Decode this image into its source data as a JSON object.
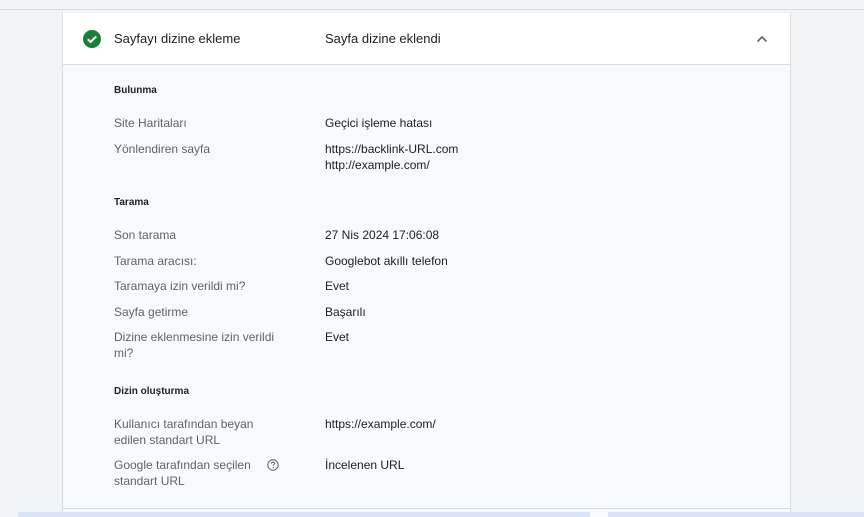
{
  "header": {
    "label": "Sayfayı dizine ekleme",
    "value": "Sayfa dizine eklendi",
    "status_icon": "check-circle-icon",
    "status_color": "#188038",
    "toggle_icon": "chevron-up-icon"
  },
  "sections": {
    "discovery": {
      "title": "Bulunma",
      "rows": [
        {
          "label": "Site Haritaları",
          "value": "Geçici işleme hatası"
        },
        {
          "label": "Yönlendiren sayfa",
          "value_line1": "https://backlink-URL.com",
          "value_line2": "http://example.com/"
        }
      ]
    },
    "crawl": {
      "title": "Tarama",
      "rows": [
        {
          "label": "Son tarama",
          "value": "27 Nis 2024 17:06:08"
        },
        {
          "label": "Tarama aracısı:",
          "value": "Googlebot akıllı telefon"
        },
        {
          "label": "Taramaya izin verildi mi?",
          "value": "Evet"
        },
        {
          "label": "Sayfa getirme",
          "value": "Başarılı"
        },
        {
          "label_line1": "Dizine eklenmesine izin verildi",
          "label_line2": "mi?",
          "value": "Evet"
        }
      ]
    },
    "indexing": {
      "title": "Dizin oluşturma",
      "rows": [
        {
          "label_line1": "Kullanıcı tarafından beyan",
          "label_line2": "edilen standart URL",
          "value": "https://example.com/"
        },
        {
          "label_line1": "Google tarafından seçilen",
          "label_line2": "standart URL",
          "value": "İncelenen URL",
          "help_icon": "help-circle-icon"
        }
      ]
    }
  }
}
